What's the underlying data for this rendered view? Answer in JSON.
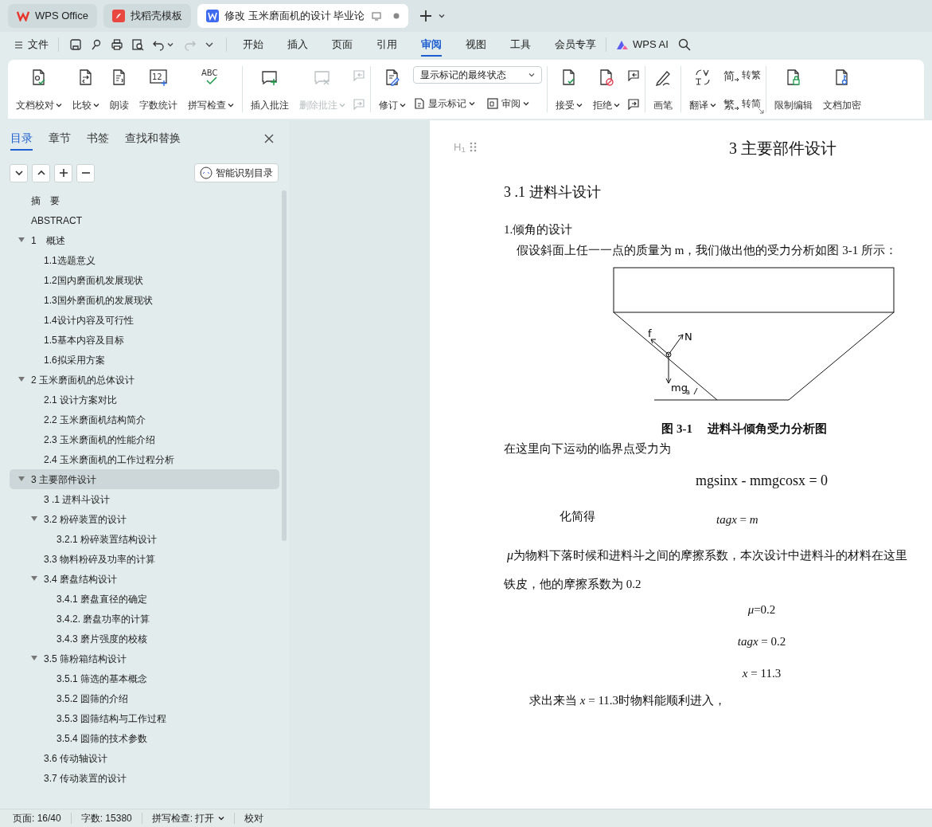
{
  "tabs": [
    {
      "kind": "home",
      "label": "WPS Office",
      "selected": false
    },
    {
      "kind": "template",
      "label": "找稻壳模板",
      "selected": false
    },
    {
      "kind": "doc",
      "label": "修改 玉米磨面机的设计 毕业论",
      "selected": true
    }
  ],
  "quick_bar": {
    "file_label": "文件"
  },
  "ribbon_tabs": [
    {
      "label": "开始",
      "selected": false
    },
    {
      "label": "插入",
      "selected": false
    },
    {
      "label": "页面",
      "selected": false
    },
    {
      "label": "引用",
      "selected": false
    },
    {
      "label": "审阅",
      "selected": true
    },
    {
      "label": "视图",
      "selected": false
    },
    {
      "label": "工具",
      "selected": false
    },
    {
      "label": "会员专享",
      "selected": false
    }
  ],
  "ai_label": "WPS AI",
  "ribbon_groups": [
    {
      "columns": [
        {
          "kind": "large",
          "label": "文档校对",
          "caret": true,
          "disabled": false
        },
        {
          "kind": "large",
          "label": "比较",
          "caret": true,
          "disabled": false
        },
        {
          "kind": "large",
          "label": "朗读",
          "caret": false,
          "disabled": false
        },
        {
          "kind": "large",
          "glyph": "12",
          "label": "字数统计",
          "caret": false,
          "disabled": false
        },
        {
          "kind": "large",
          "glyph": "ABC",
          "label": "拼写检查",
          "caret": true,
          "disabled": false
        }
      ]
    },
    {
      "columns": [
        {
          "kind": "large",
          "label": "插入批注",
          "caret": false,
          "disabled": false
        },
        {
          "kind": "large",
          "label": "删除批注",
          "caret": true,
          "disabled": true
        },
        {
          "kind": "stack",
          "items": [
            {
              "caret": false,
              "disabled": true
            },
            {
              "caret": false,
              "disabled": true
            }
          ]
        }
      ]
    },
    {
      "columns": [
        {
          "kind": "large",
          "label": "修订",
          "caret": true,
          "disabled": false
        },
        {
          "kind": "markup",
          "value": "显示标记的最终状态",
          "items": [
            {
              "label": "显示标记",
              "caret": true,
              "disabled": false
            },
            {
              "label": "审阅",
              "caret": true,
              "disabled": false
            }
          ]
        }
      ]
    },
    {
      "columns": [
        {
          "kind": "large",
          "label": "接受",
          "caret": true,
          "disabled": false
        },
        {
          "kind": "large",
          "label": "拒绝",
          "caret": true,
          "disabled": false
        },
        {
          "kind": "stack",
          "items": [
            {
              "caret": false,
              "disabled": false
            },
            {
              "caret": false,
              "disabled": false
            }
          ]
        }
      ]
    },
    {
      "columns": [
        {
          "kind": "large",
          "label": "画笔",
          "caret": false,
          "disabled": false
        }
      ]
    },
    {
      "columns": [
        {
          "kind": "large",
          "label": "翻译",
          "caret": true,
          "disabled": false
        },
        {
          "kind": "stack",
          "items": [
            {
              "glyph": "简",
              "label": "转繁",
              "caret": false,
              "disabled": false
            },
            {
              "glyph": "繁",
              "label": "转简",
              "caret": false,
              "disabled": false
            }
          ]
        }
      ]
    },
    {
      "columns": [
        {
          "kind": "large",
          "label": "限制编辑",
          "caret": false,
          "disabled": false
        },
        {
          "kind": "large",
          "label": "文档加密",
          "caret": false,
          "disabled": false
        }
      ]
    }
  ],
  "nav": {
    "tabs": [
      {
        "label": "目录",
        "selected": true
      },
      {
        "label": "章节",
        "selected": false
      },
      {
        "label": "书签",
        "selected": false
      },
      {
        "label": "查找和替换",
        "selected": false
      }
    ],
    "smart_button": "智能识别目录",
    "toc": [
      {
        "label": "摘　要",
        "selected": false
      },
      {
        "label": "ABSTRACT",
        "selected": false
      },
      {
        "label": "1　概述",
        "selected": false,
        "expanded": true,
        "children": [
          {
            "label": "1.1选题意义",
            "selected": false
          },
          {
            "label": "1.2国内磨面机发展现状",
            "selected": false
          },
          {
            "label": "1.3国外磨面机的发展现状",
            "selected": false
          },
          {
            "label": "1.4设计内容及可行性",
            "selected": false
          },
          {
            "label": "1.5基本内容及目标",
            "selected": false
          },
          {
            "label": "1.6拟采用方案",
            "selected": false
          }
        ]
      },
      {
        "label": "2  玉米磨面机的总体设计",
        "selected": false,
        "expanded": true,
        "children": [
          {
            "label": "2.1 设计方案对比",
            "selected": false
          },
          {
            "label": "2.2  玉米磨面机结构简介",
            "selected": false
          },
          {
            "label": "2.3 玉米磨面机的性能介绍",
            "selected": false
          },
          {
            "label": "2.4  玉米磨面机的工作过程分析",
            "selected": false
          }
        ]
      },
      {
        "label": "3  主要部件设计",
        "selected": true,
        "expanded": true,
        "children": [
          {
            "label": "3 .1  进料斗设计",
            "selected": false
          },
          {
            "label": "3.2 粉碎装置的设计",
            "selected": false,
            "expanded": true,
            "children": [
              {
                "label": "3.2.1  粉碎装置结构设计",
                "selected": false
              }
            ]
          },
          {
            "label": "3.3  物料粉碎及功率的计算",
            "selected": false
          },
          {
            "label": "3.4  磨盘结构设计",
            "selected": false,
            "expanded": true,
            "children": [
              {
                "label": "3.4.1  磨盘直径的确定",
                "selected": false
              },
              {
                "label": "3.4.2.  磨盘功率的计算",
                "selected": false
              },
              {
                "label": "3.4.3 磨片强度的校核",
                "selected": false
              }
            ]
          },
          {
            "label": "3.5  筛粉箱结构设计",
            "selected": false,
            "expanded": true,
            "children": [
              {
                "label": "3.5.1  筛选的基本概念",
                "selected": false
              },
              {
                "label": "3.5.2 圆筛的介绍",
                "selected": false
              },
              {
                "label": "3.5.3  圆筛结构与工作过程",
                "selected": false
              },
              {
                "label": "3.5.4  圆筛的技术参数",
                "selected": false
              }
            ]
          },
          {
            "label": "3.6  传动轴设计",
            "selected": false
          },
          {
            "label": "3.7  传动装置的设计",
            "selected": false
          }
        ]
      }
    ]
  },
  "document": {
    "heading_marker": "H$_{1}$",
    "chapter_title": "3  主要部件设计",
    "section_title": "3 .1  进料斗设计",
    "blocks": [
      {
        "kind": "para",
        "text": "1.倾角的设计"
      },
      {
        "kind": "para",
        "text": "假设斜面上任一一点的质量为 m，我们做出他的受力分析如图 3-1 所示："
      },
      {
        "kind": "figure",
        "labels": [
          "f",
          "N",
          "mg",
          "a"
        ],
        "caption": "图 3-1　 进料斗倾角受力分析图"
      },
      {
        "kind": "para",
        "text": "在这里向下运动的临界点受力为"
      },
      {
        "kind": "equation",
        "text": "mgsinx - mmgcosx = 0"
      },
      {
        "kind": "labeled",
        "label": "化简得",
        "text": "*tagx* = *m*"
      },
      {
        "kind": "symbol_para",
        "symbol": "μ",
        "text": "为物料下落时候和进料斗之间的摩擦系数，本次设计中进料斗的材料在这里"
      },
      {
        "kind": "para",
        "text": "铁皮，他的摩擦系数为 0.2"
      },
      {
        "kind": "equation",
        "text": "*μ*=0.2"
      },
      {
        "kind": "equation",
        "text": "*tagx* = 0.2"
      },
      {
        "kind": "equation",
        "text": "*x* = 11.3"
      },
      {
        "kind": "para",
        "text": "求出来当 *x* = 11.3时物料能顺利进入，"
      }
    ]
  },
  "status_bar": [
    {
      "kind": "text",
      "label": "页面: 16/40"
    },
    {
      "kind": "text",
      "label": "字数: 15380"
    },
    {
      "kind": "menu",
      "label": "拼写检查: 打开"
    },
    {
      "kind": "text",
      "label": "校对"
    }
  ]
}
